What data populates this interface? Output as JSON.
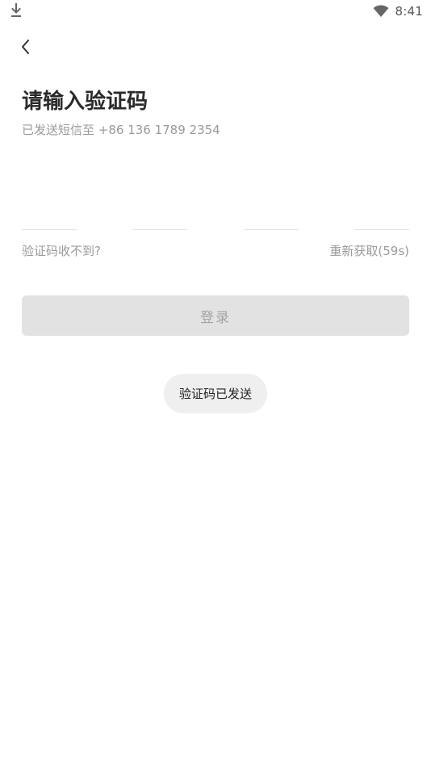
{
  "status_bar": {
    "time": "8:41",
    "download_icon": "download-icon",
    "wifi_icon": "wifi-icon"
  },
  "header": {
    "back_icon": "chevron-left-icon"
  },
  "main": {
    "title": "请输入验证码",
    "subtitle": "已发送短信至 +86 136 1789 2354",
    "code_slots": [
      "",
      "",
      "",
      ""
    ],
    "help_link": "验证码收不到?",
    "resend_link": "重新获取(59s)",
    "login_button": "登录"
  },
  "toast": {
    "message": "验证码已发送"
  },
  "colors": {
    "background": "#ffffff",
    "title": "#2a2a2a",
    "muted_text": "#9a9a9a",
    "button_disabled_bg": "#e2e2e2",
    "button_disabled_text": "#a2a2a2",
    "toast_bg": "#efefef"
  }
}
